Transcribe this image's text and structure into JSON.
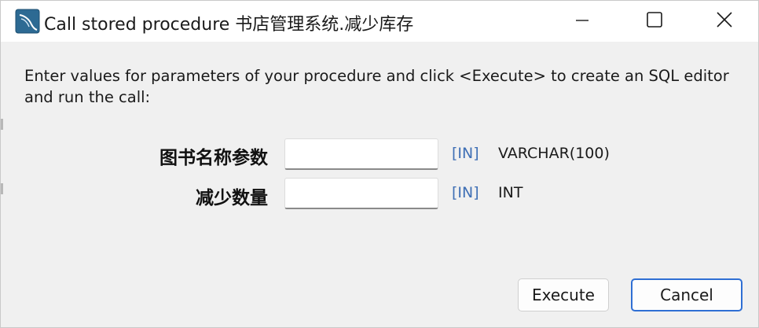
{
  "window": {
    "title": "Call stored procedure 书店管理系统.减少库存",
    "icon": "mysql-workbench-icon"
  },
  "window_controls": {
    "minimize": "minimize-icon",
    "maximize": "maximize-icon",
    "close": "close-icon"
  },
  "description": "Enter values for parameters of your procedure and click <Execute> to create an SQL editor and run the call:",
  "parameters": [
    {
      "label": "图书名称参数",
      "value": "",
      "mode": "[IN]",
      "type": "VARCHAR(100)"
    },
    {
      "label": "减少数量",
      "value": "",
      "mode": "[IN]",
      "type": "INT"
    }
  ],
  "buttons": {
    "execute": "Execute",
    "cancel": "Cancel"
  },
  "colors": {
    "accent": "#2f6fd4",
    "mode_text": "#3f6fb5",
    "dialog_bg": "#f0f0f0"
  }
}
